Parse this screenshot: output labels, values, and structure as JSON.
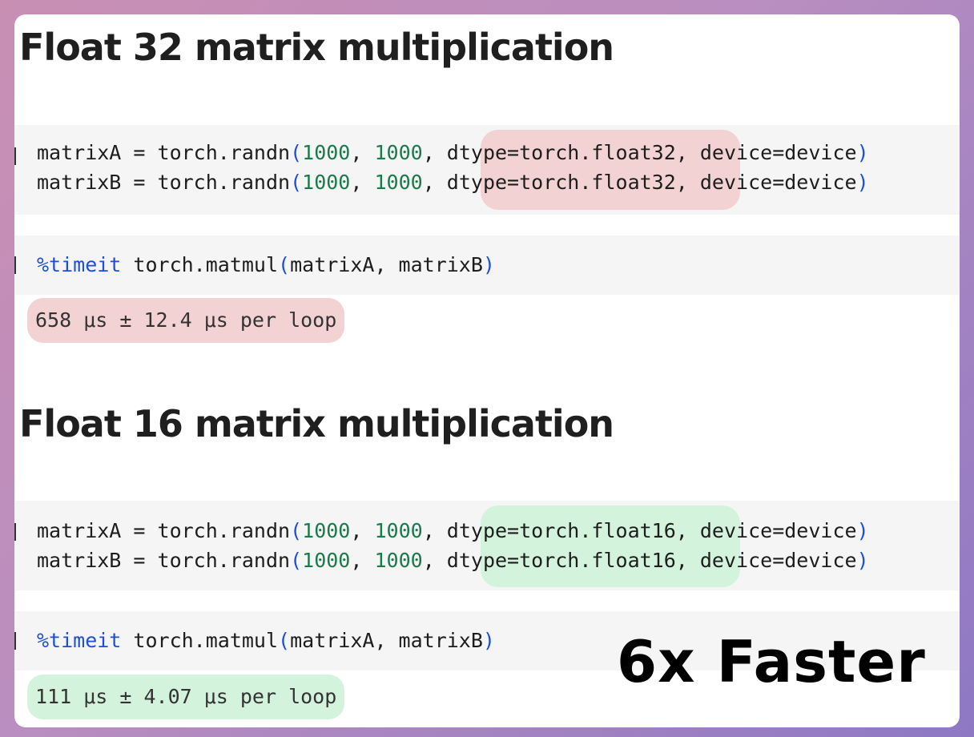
{
  "sections": [
    {
      "heading": "Float 32 matrix multiplication",
      "code_lines": [
        {
          "var": "matrixA",
          "eq": " = torch.randn",
          "lp": "(",
          "n1": "1000",
          "c1": ", ",
          "n2": "1000",
          "c2": ", ",
          "dtype": "dtype=torch.float32",
          "rest": ", device=device",
          "rp": ")"
        },
        {
          "var": "matrixB",
          "eq": " = torch.randn",
          "lp": "(",
          "n1": "1000",
          "c1": ", ",
          "n2": "1000",
          "c2": ", ",
          "dtype": "dtype=torch.float32",
          "rest": ", device=device",
          "rp": ")"
        }
      ],
      "timeit": {
        "magic": "%timeit",
        "call": " torch.matmul",
        "lp": "(",
        "args": "matrixA, matrixB",
        "rp": ")"
      },
      "output": "658 μs ± 12.4 μs per loop"
    },
    {
      "heading": "Float 16 matrix multiplication",
      "code_lines": [
        {
          "var": "matrixA",
          "eq": " = torch.randn",
          "lp": "(",
          "n1": "1000",
          "c1": ", ",
          "n2": "1000",
          "c2": ", ",
          "dtype": "dtype=torch.float16",
          "rest": ", device=device",
          "rp": ")"
        },
        {
          "var": "matrixB",
          "eq": " = torch.randn",
          "lp": "(",
          "n1": "1000",
          "c1": ", ",
          "n2": "1000",
          "c2": ", ",
          "dtype": "dtype=torch.float16",
          "rest": ", device=device",
          "rp": ")"
        }
      ],
      "timeit": {
        "magic": "%timeit",
        "call": " torch.matmul",
        "lp": "(",
        "args": "matrixA, matrixB",
        "rp": ")"
      },
      "output": "111 μs ± 4.07 μs per loop"
    }
  ],
  "badge": "6x Faster",
  "colors": {
    "highlight_red": "#f2d2d2",
    "highlight_green": "#d3f3dc",
    "number": "#1b7a4a",
    "paren": "#1d4fd8"
  }
}
